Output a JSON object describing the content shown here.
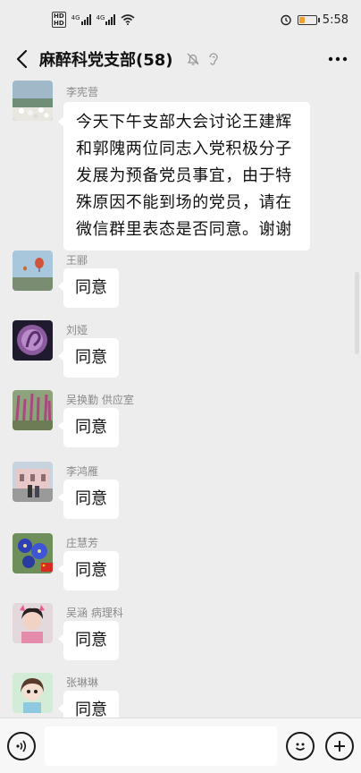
{
  "status": {
    "time": "5:58",
    "hd_label": [
      "HD",
      "HD"
    ],
    "network1": "4G",
    "network2": "4G"
  },
  "header": {
    "title": "麻醉科党支部(58)"
  },
  "messages": [
    {
      "sender": "李宪营",
      "lines": [
        "今天下午支部大会讨论王建辉",
        "和郭隗两位同志入党积极分子",
        "发展为预备党员事宜，由于特",
        "殊原因不能到场的党员，请在",
        "微信群里表态是否同意。谢谢"
      ]
    },
    {
      "sender": "王郦",
      "text": "同意"
    },
    {
      "sender": "刘娅",
      "text": "同意"
    },
    {
      "sender": "吴换勤  供应室",
      "text": "同意"
    },
    {
      "sender": "李鸿雁",
      "text": "同意"
    },
    {
      "sender": "庄慧芳",
      "text": "同意"
    },
    {
      "sender": "吴涵   病理科",
      "text": "同意"
    },
    {
      "sender": "张琳琳",
      "text": "同意"
    }
  ],
  "colors": {
    "background": "#ededed",
    "bubble": "#ffffff",
    "battery": "#f0a030"
  },
  "icons": [
    "chevron-left-icon",
    "mute-bell-icon",
    "ear-icon",
    "more-icon",
    "voice-icon",
    "emoji-icon",
    "plus-icon"
  ]
}
